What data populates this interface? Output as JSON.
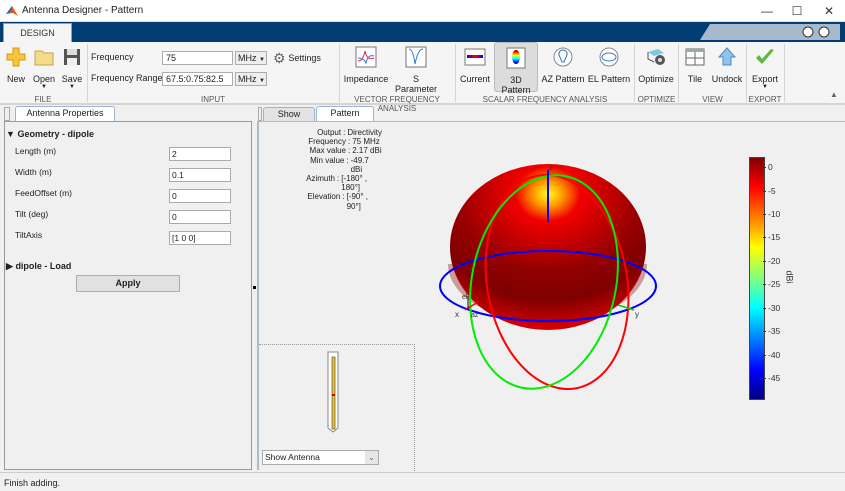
{
  "window": {
    "title": "Antenna Designer - Pattern",
    "controls": [
      "minimize",
      "maximize",
      "close"
    ]
  },
  "ribbon": {
    "tab": "DESIGN",
    "file": {
      "label": "FILE",
      "new": "New",
      "open": "Open",
      "save": "Save"
    },
    "input": {
      "label": "INPUT",
      "frequency_label": "Frequency",
      "frequency_value": "75",
      "frequency_unit": "MHz",
      "range_label": "Frequency Range",
      "range_value": "67.5:0.75:82.5",
      "range_unit": "MHz",
      "settings": "Settings"
    },
    "vector": {
      "label": "VECTOR FREQUENCY ANALYSIS",
      "impedance": "Impedance",
      "sparam": "S Parameter"
    },
    "scalar": {
      "label": "SCALAR FREQUENCY ANALYSIS",
      "current": "Current",
      "pattern3d": "3D Pattern",
      "az": "AZ Pattern",
      "el": "EL Pattern"
    },
    "optimize": {
      "label": "OPTIMIZE",
      "optimize": "Optimize"
    },
    "view": {
      "label": "VIEW",
      "tile": "Tile",
      "undock": "Undock"
    },
    "export": {
      "label": "EXPORT",
      "export": "Export"
    }
  },
  "left": {
    "tab": "Antenna Properties",
    "section": "Geometry - dipole",
    "props": [
      {
        "label": "Length (m)",
        "value": "2"
      },
      {
        "label": "Width (m)",
        "value": "0.1"
      },
      {
        "label": "FeedOffset (m)",
        "value": "0"
      },
      {
        "label": "Tilt (deg)",
        "value": "0"
      },
      {
        "label": "TiltAxis",
        "value": "[1 0 0]"
      }
    ],
    "load_section": "dipole - Load",
    "apply": "Apply"
  },
  "right": {
    "tabs": [
      "Show",
      "Pattern"
    ],
    "active_tab": "Pattern",
    "info": [
      {
        "k": "Output",
        "v": "Directivity"
      },
      {
        "k": "Frequency",
        "v": "75 MHz"
      },
      {
        "k": "Max value",
        "v": "2.17 dBi"
      },
      {
        "k": "Min value",
        "v": "-49.7 dBi"
      },
      {
        "k": "Azimuth",
        "v": "[-180° , 180°]"
      },
      {
        "k": "Elevation",
        "v": "[-90° , 90°]"
      }
    ],
    "axis_labels": {
      "z": "z",
      "x": "x",
      "y": "y",
      "el": "el",
      "az": "az"
    },
    "colorbar": {
      "label": "dBi",
      "ticks": [
        "0",
        "-5",
        "-10",
        "-15",
        "-20",
        "-25",
        "-30",
        "-35",
        "-40",
        "-45"
      ],
      "range": [
        -49.7,
        2.17
      ]
    },
    "show_select": "Show Antenna"
  },
  "status": "Finish adding."
}
